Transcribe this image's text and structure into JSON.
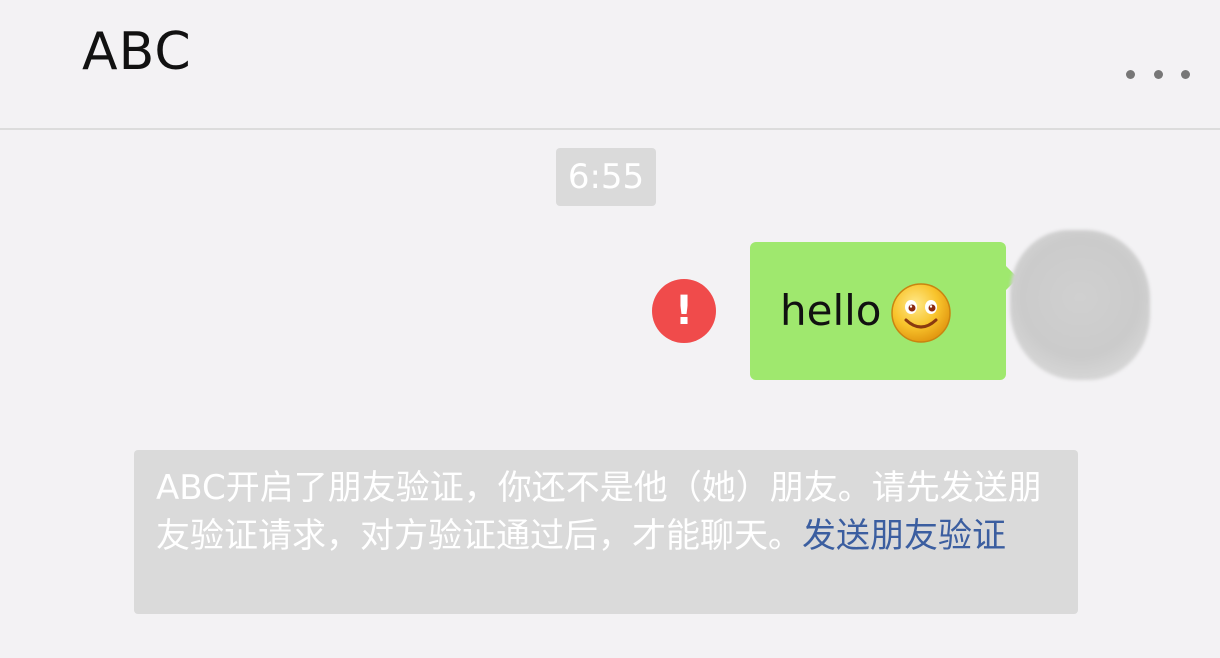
{
  "header": {
    "title": "ABC",
    "more_icon": "more-dots-icon"
  },
  "chat": {
    "timestamp": "6:55",
    "messages": [
      {
        "text": "hello",
        "emoji": "smiley-icon",
        "status_icon": "error-icon",
        "status_symbol": "!"
      }
    ],
    "notice": {
      "text": "ABC开启了朋友验证，你还不是他（她）朋友。请先发送朋友验证请求，对方验证通过后，才能聊天。",
      "link": "发送朋友验证"
    }
  },
  "colors": {
    "bubble": "#9fe86e",
    "error": "#f04b4b",
    "link": "#3b5ea0",
    "background": "#f3f2f4"
  }
}
